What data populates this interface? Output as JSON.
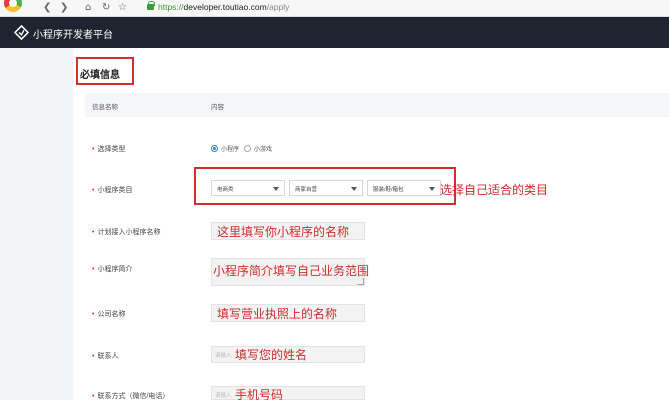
{
  "browser": {
    "url_protocol": "https://",
    "url_host": "developer.toutiao.com",
    "url_path": "/apply",
    "back_glyph": "❮",
    "forward_glyph": "❯",
    "home_glyph": "⌂",
    "reload_glyph": "↻",
    "bookmark_glyph": "☆"
  },
  "header": {
    "title": "小程序开发者平台"
  },
  "section": {
    "title": "必填信息"
  },
  "table": {
    "col_name": "信息名称",
    "col_content": "内容"
  },
  "rows": {
    "type": {
      "label": "选择类型",
      "options": [
        {
          "label": "小程序",
          "selected": true
        },
        {
          "label": "小游戏",
          "selected": false
        }
      ]
    },
    "category": {
      "label": "小程序类目",
      "selects": [
        "电商类",
        "商家自营",
        "服装/鞋/箱包"
      ],
      "annotation": "选择自己适合的类目"
    },
    "name": {
      "label": "计划接入小程序名称",
      "annotation": "这里填写你小程序的名称"
    },
    "intro": {
      "label": "小程序简介",
      "annotation": "小程序简介填写自己业务范围"
    },
    "company": {
      "label": "公司名称",
      "annotation": "填写营业执照上的名称"
    },
    "contact": {
      "label": "联系人",
      "placeholder": "请输入",
      "annotation": "填写您的姓名"
    },
    "phone": {
      "label": "联系方式（微信/电话）",
      "placeholder": "请输入",
      "annotation": "手机号码"
    }
  },
  "colors": {
    "accent": "#3b82f6",
    "annotation": "#d12a2a",
    "header_bg": "#1f2430"
  }
}
